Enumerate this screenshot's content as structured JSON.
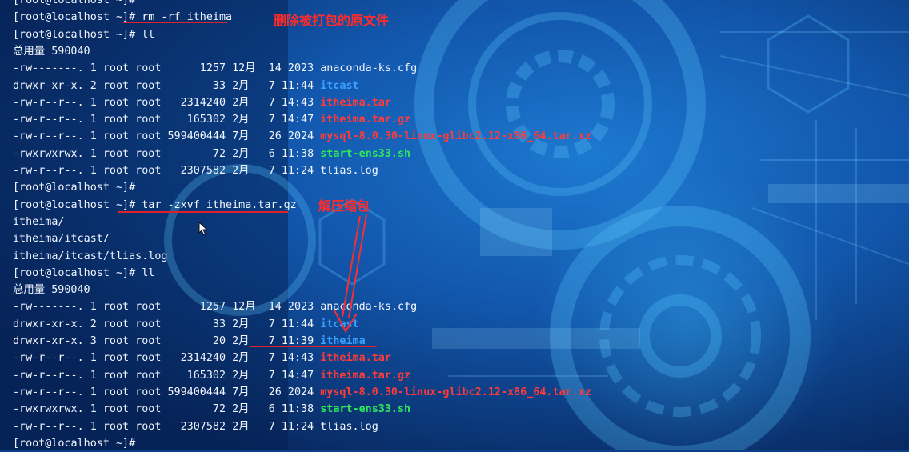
{
  "terminal": {
    "lines": [
      [
        {
          "t": "[root@localhost ~]#",
          "c": "normal"
        }
      ],
      [
        {
          "t": "[root@localhost ~]# rm -rf itheima",
          "c": "normal"
        }
      ],
      [
        {
          "t": "[root@localhost ~]# ll",
          "c": "normal"
        }
      ],
      [
        {
          "t": "总用量 590040",
          "c": "normal"
        }
      ],
      [
        {
          "t": "-rw-------. 1 root root      1257 12月  14 2023 anaconda-ks.cfg",
          "c": "normal"
        }
      ],
      [
        {
          "t": "drwxr-xr-x. 2 root root        33 2月   7 11:44 ",
          "c": "normal"
        },
        {
          "t": "itcast",
          "c": "dir"
        }
      ],
      [
        {
          "t": "-rw-r--r--. 1 root root   2314240 2月   7 14:43 ",
          "c": "normal"
        },
        {
          "t": "itheima.tar",
          "c": "arch"
        }
      ],
      [
        {
          "t": "-rw-r--r--. 1 root root    165302 2月   7 14:47 ",
          "c": "normal"
        },
        {
          "t": "itheima.tar.gz",
          "c": "arch"
        }
      ],
      [
        {
          "t": "-rw-r--r--. 1 root root 599400444 7月   26 2024 ",
          "c": "normal"
        },
        {
          "t": "mysql-8.0.30-linux-glibc2.12-x86_64.tar.xz",
          "c": "arch"
        }
      ],
      [
        {
          "t": "-rwxrwxrwx. 1 root root        72 2月   6 11:38 ",
          "c": "normal"
        },
        {
          "t": "start-ens33.sh",
          "c": "exec"
        }
      ],
      [
        {
          "t": "-rw-r--r--. 1 root root   2307582 2月   7 11:24 tlias.log",
          "c": "normal"
        }
      ],
      [
        {
          "t": "[root@localhost ~]#",
          "c": "normal"
        }
      ],
      [
        {
          "t": "[root@localhost ~]# tar -zxvf itheima.tar.gz",
          "c": "normal"
        }
      ],
      [
        {
          "t": "itheima/",
          "c": "normal"
        }
      ],
      [
        {
          "t": "itheima/itcast/",
          "c": "normal"
        }
      ],
      [
        {
          "t": "itheima/itcast/tlias.log",
          "c": "normal"
        }
      ],
      [
        {
          "t": "[root@localhost ~]# ll",
          "c": "normal"
        }
      ],
      [
        {
          "t": "总用量 590040",
          "c": "normal"
        }
      ],
      [
        {
          "t": "-rw-------. 1 root root      1257 12月  14 2023 anaconda-ks.cfg",
          "c": "normal"
        }
      ],
      [
        {
          "t": "drwxr-xr-x. 2 root root        33 2月   7 11:44 ",
          "c": "normal"
        },
        {
          "t": "itcast",
          "c": "dir"
        }
      ],
      [
        {
          "t": "drwxr-xr-x. 3 root root        20 2月   7 11:39 ",
          "c": "normal"
        },
        {
          "t": "itheima",
          "c": "dir"
        }
      ],
      [
        {
          "t": "-rw-r--r--. 1 root root   2314240 2月   7 14:43 ",
          "c": "normal"
        },
        {
          "t": "itheima.tar",
          "c": "arch"
        }
      ],
      [
        {
          "t": "-rw-r--r--. 1 root root    165302 2月   7 14:47 ",
          "c": "normal"
        },
        {
          "t": "itheima.tar.gz",
          "c": "arch"
        }
      ],
      [
        {
          "t": "-rw-r--r--. 1 root root 599400444 7月   26 2024 ",
          "c": "normal"
        },
        {
          "t": "mysql-8.0.30-linux-glibc2.12-x86_64.tar.xz",
          "c": "arch"
        }
      ],
      [
        {
          "t": "-rwxrwxrwx. 1 root root        72 2月   6 11:38 ",
          "c": "normal"
        },
        {
          "t": "start-ens33.sh",
          "c": "exec"
        }
      ],
      [
        {
          "t": "-rw-r--r--. 1 root root   2307582 2月   7 11:24 tlias.log",
          "c": "normal"
        }
      ],
      [
        {
          "t": "[root@localhost ~]#",
          "c": "normal"
        }
      ]
    ]
  },
  "annotations": {
    "delete_note": "删除被打包的原文件",
    "extract_note": "解压缩包"
  },
  "colors": {
    "background": "#0b3f86",
    "text": "#f2f6ff",
    "directory": "#3aa0ff",
    "archive": "#ff3b3b",
    "executable": "#2ee85a",
    "annotation": "#ff2c2c"
  },
  "icons": {
    "mouse_cursor": "mouse-pointer-icon"
  }
}
